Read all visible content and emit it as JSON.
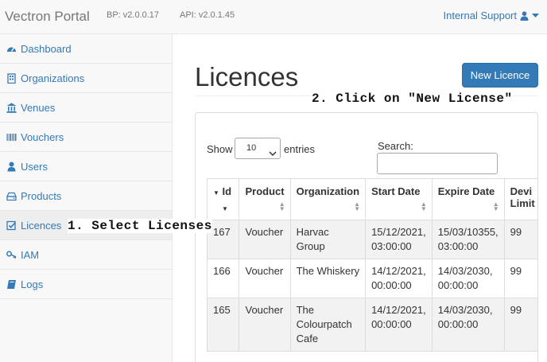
{
  "navbar": {
    "brand": "Vectron Portal",
    "bp_version": "BP: v2.0.0.17",
    "api_version": "API: v2.0.1.45",
    "user_menu": "Internal Support"
  },
  "sidebar": {
    "items": [
      {
        "label": "Dashboard",
        "icon": "dashboard-icon"
      },
      {
        "label": "Organizations",
        "icon": "building-icon"
      },
      {
        "label": "Venues",
        "icon": "bank-icon"
      },
      {
        "label": "Vouchers",
        "icon": "barcode-icon"
      },
      {
        "label": "Users",
        "icon": "user-icon"
      },
      {
        "label": "Products",
        "icon": "hdd-icon"
      },
      {
        "label": "Licences",
        "icon": "check-square-icon",
        "active": true
      },
      {
        "label": "IAM",
        "icon": "key-icon"
      },
      {
        "label": "Logs",
        "icon": "book-icon"
      }
    ]
  },
  "main": {
    "title": "Licences",
    "new_button": "New Licence"
  },
  "annotations": {
    "step1": "1. Select Licenses",
    "step2": "2. Click on \"New License\""
  },
  "table_controls": {
    "show_label": "Show",
    "page_length": "10",
    "entries_label": "entries",
    "search_label": "Search:"
  },
  "table": {
    "headers": [
      "Id",
      "Product",
      "Organization",
      "Start Date",
      "Expire Date",
      "Device Limit"
    ],
    "header_lines": {
      "dev_line1": "Devi",
      "dev_line2": "Limit"
    },
    "rows": [
      {
        "id": "167",
        "product": "Voucher",
        "org": "Harvac Group",
        "start": "15/12/2021, 03:00:00",
        "expire": "15/03/10355, 03:00:00",
        "limit": "99"
      },
      {
        "id": "166",
        "product": "Voucher",
        "org": "The Whiskery",
        "start": "14/12/2021, 00:00:00",
        "expire": "14/03/2030, 00:00:00",
        "limit": "99"
      },
      {
        "id": "165",
        "product": "Voucher",
        "org": "The Colourpatch Cafe",
        "start": "14/12/2021, 00:00:00",
        "expire": "14/03/2030, 00:00:00",
        "limit": "99"
      }
    ]
  },
  "colors": {
    "primary": "#337ab7",
    "sidebar_bg": "#f8f8f8",
    "striped_row": "#f2f2f2"
  }
}
